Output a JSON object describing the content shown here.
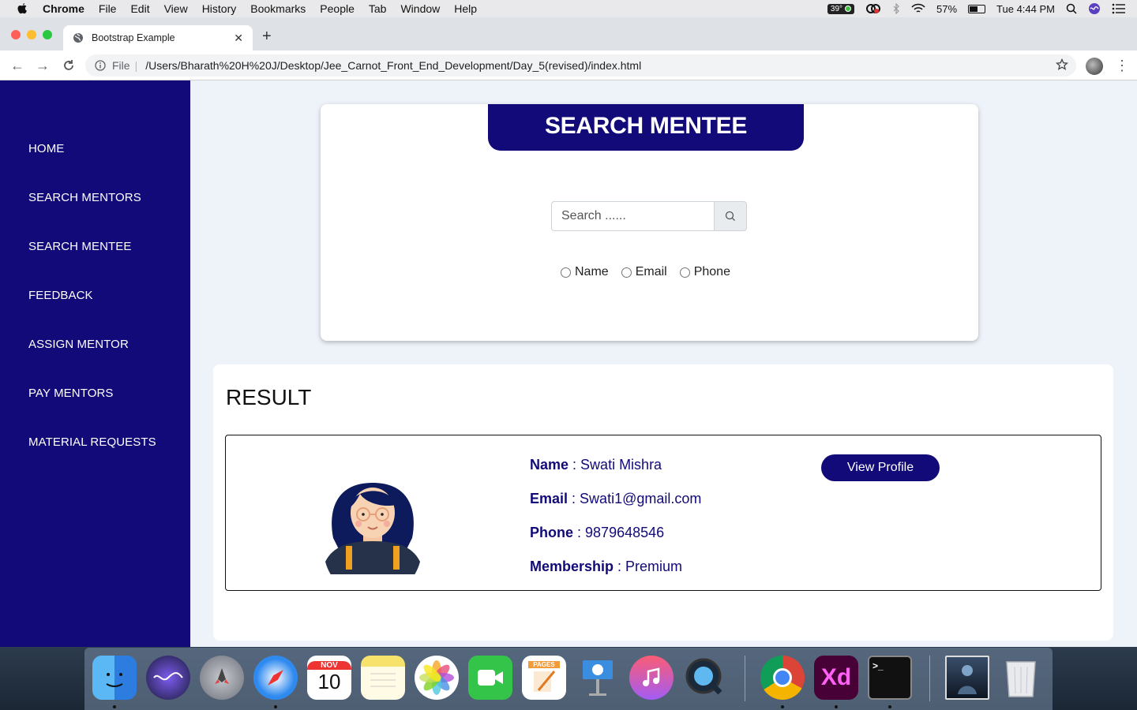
{
  "menubar": {
    "app_name": "Chrome",
    "items": [
      "File",
      "Edit",
      "View",
      "History",
      "Bookmarks",
      "People",
      "Tab",
      "Window",
      "Help"
    ],
    "temperature": "39°",
    "battery": "57%",
    "battery_level": 0.57,
    "clock": "Tue 4:44 PM"
  },
  "browser": {
    "tab_title": "Bootstrap Example",
    "url_scheme_label": "File",
    "url": "/Users/Bharath%20H%20J/Desktop/Jee_Carnot_Front_End_Development/Day_5(revised)/index.html"
  },
  "sidebar": {
    "items": [
      {
        "label": "HOME"
      },
      {
        "label": "SEARCH MENTORS"
      },
      {
        "label": "SEARCH MENTEE"
      },
      {
        "label": "FEEDBACK"
      },
      {
        "label": "ASSIGN MENTOR"
      },
      {
        "label": "PAY MENTORS"
      },
      {
        "label": "MATERIAL REQUESTS"
      }
    ]
  },
  "search": {
    "title": "SEARCH MENTEE",
    "placeholder": "Search ......",
    "filters": [
      {
        "label": "Name",
        "checked": false
      },
      {
        "label": "Email",
        "checked": false
      },
      {
        "label": "Phone",
        "checked": false
      }
    ]
  },
  "result": {
    "title": "RESULT",
    "mentee": {
      "name_key": "Name",
      "name": "Swati Mishra",
      "email_key": "Email",
      "email": "Swati1@gmail.com",
      "phone_key": "Phone",
      "phone": "9879648546",
      "membership_key": "Membership",
      "membership": "Premium",
      "button_label": "View Profile"
    }
  },
  "dock": {
    "calendar_month": "NOV",
    "calendar_day": "10",
    "pages_label": "PAGES",
    "xd_label": "Xd",
    "terminal_prompt": ">_"
  },
  "colors": {
    "brand": "#120a78",
    "page_bg": "#eef2f9"
  }
}
